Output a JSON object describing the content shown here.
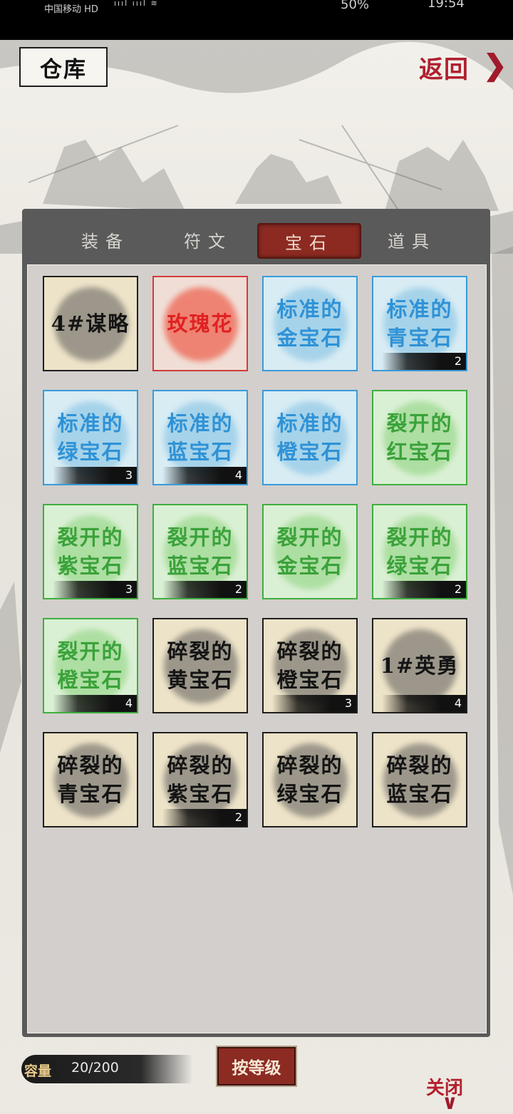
{
  "status_bar": {
    "carrier": "中国移动 HD",
    "signal": "ıııl  ıııl  ≋",
    "battery": "50%",
    "time": "19:54"
  },
  "header": {
    "title": "仓库",
    "back_label": "返回",
    "back_arrow": "❯"
  },
  "tabs": [
    {
      "label": "装备",
      "active": false
    },
    {
      "label": "符文",
      "active": false
    },
    {
      "label": "宝石",
      "active": true
    },
    {
      "label": "道具",
      "active": false
    }
  ],
  "items": [
    {
      "name": "4#谋略",
      "tier": "black",
      "count": ""
    },
    {
      "name": "玫瑰花",
      "tier": "red",
      "count": ""
    },
    {
      "name": "标准的金宝石",
      "tier": "blue",
      "count": ""
    },
    {
      "name": "标准的青宝石",
      "tier": "blue",
      "count": "2"
    },
    {
      "name": "标准的绿宝石",
      "tier": "blue",
      "count": "3"
    },
    {
      "name": "标准的蓝宝石",
      "tier": "blue",
      "count": "4"
    },
    {
      "name": "标准的橙宝石",
      "tier": "blue",
      "count": ""
    },
    {
      "name": "裂开的红宝石",
      "tier": "green",
      "count": ""
    },
    {
      "name": "裂开的紫宝石",
      "tier": "green",
      "count": "3"
    },
    {
      "name": "裂开的蓝宝石",
      "tier": "green",
      "count": "2"
    },
    {
      "name": "裂开的金宝石",
      "tier": "green",
      "count": ""
    },
    {
      "name": "裂开的绿宝石",
      "tier": "green",
      "count": "2"
    },
    {
      "name": "裂开的橙宝石",
      "tier": "green",
      "count": "4"
    },
    {
      "name": "碎裂的黄宝石",
      "tier": "black",
      "count": ""
    },
    {
      "name": "碎裂的橙宝石",
      "tier": "black",
      "count": "3"
    },
    {
      "name": "1#英勇",
      "tier": "black",
      "count": "4"
    },
    {
      "name": "碎裂的青宝石",
      "tier": "black",
      "count": ""
    },
    {
      "name": "碎裂的紫宝石",
      "tier": "black",
      "count": "2"
    },
    {
      "name": "碎裂的绿宝石",
      "tier": "black",
      "count": ""
    },
    {
      "name": "碎裂的蓝宝石",
      "tier": "black",
      "count": ""
    }
  ],
  "footer": {
    "capacity_label": "容量",
    "capacity_value": "20/200",
    "sort_label": "按等级",
    "close_label": "关闭",
    "close_chevron": "∨"
  },
  "colors": {
    "tab_active": "#8c2a22",
    "panel": "#5a5a5a",
    "blue_tier": "#2f92d6",
    "green_tier": "#3aa23a",
    "red_tier": "#e02222"
  }
}
